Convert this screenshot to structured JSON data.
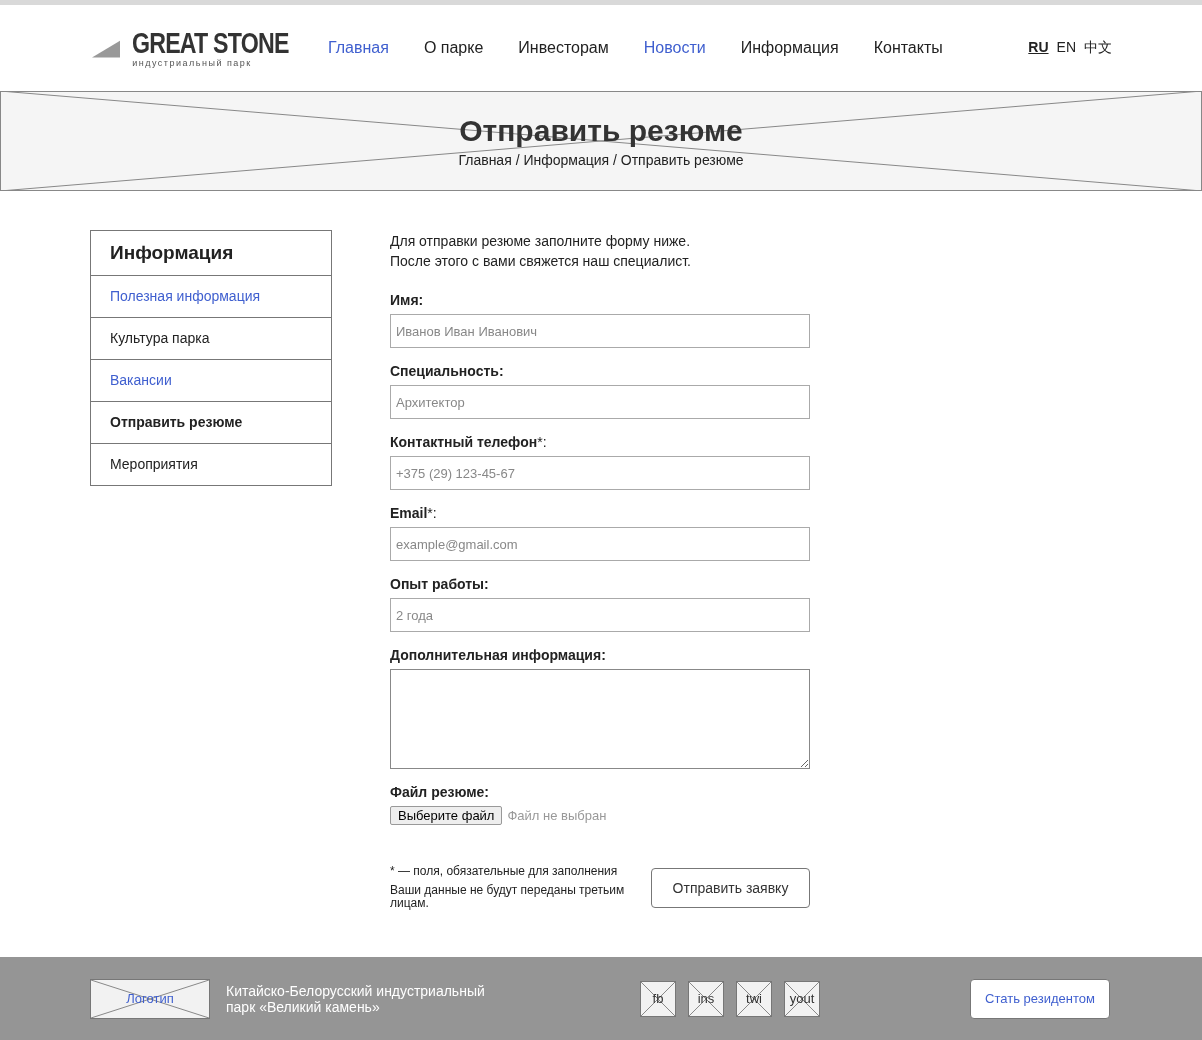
{
  "header": {
    "logo": {
      "title": "GREAT STONE",
      "subtitle": "индустриальный парк"
    },
    "nav": [
      {
        "label": "Главная",
        "kind": "link"
      },
      {
        "label": "О парке",
        "kind": "plain"
      },
      {
        "label": "Инвесторам",
        "kind": "plain"
      },
      {
        "label": "Новости",
        "kind": "link"
      },
      {
        "label": "Информация",
        "kind": "plain"
      },
      {
        "label": "Контакты",
        "kind": "plain"
      }
    ],
    "languages": [
      {
        "label": "RU",
        "selected": true
      },
      {
        "label": "EN",
        "selected": false
      },
      {
        "label": "中文",
        "selected": false
      }
    ]
  },
  "banner": {
    "title": "Отправить резюме",
    "breadcrumbs": "Главная / Информация / Отправить резюме"
  },
  "sidebar": {
    "title": "Информация",
    "items": [
      {
        "label": "Полезная информация",
        "kind": "link",
        "selected": false
      },
      {
        "label": "Культура парка",
        "kind": "plain",
        "selected": false
      },
      {
        "label": "Вакансии",
        "kind": "link",
        "selected": false
      },
      {
        "label": "Отправить резюме",
        "kind": "plain",
        "selected": true
      },
      {
        "label": "Мероприятия",
        "kind": "plain",
        "selected": false
      }
    ]
  },
  "form": {
    "intro": [
      "Для отправки резюме заполните форму ниже.",
      "После этого с вами свяжется наш специалист."
    ],
    "fields": [
      {
        "kind": "input",
        "label": "Имя:",
        "placeholder": "Иванов Иван Иванович"
      },
      {
        "kind": "input",
        "label": "Специальность:",
        "placeholder": "Архитектор"
      },
      {
        "kind": "input",
        "label": "Контактный телефон",
        "required_mark": "*:",
        "placeholder": "+375 (29) 123-45-67"
      },
      {
        "kind": "input",
        "label": "Email",
        "required_mark": "*:",
        "placeholder": "example@gmail.com"
      },
      {
        "kind": "input",
        "label": "Опыт работы:",
        "placeholder": "2 года"
      },
      {
        "kind": "textarea",
        "label": "Дополнительная информация:"
      },
      {
        "kind": "file",
        "label": "Файл резюме:",
        "button": "Выберите файл",
        "status": "Файл не выбран"
      }
    ],
    "required_note": "* — поля, обязательные для заполнения",
    "privacy_note": "Ваши данные не будут переданы третьим лицам.",
    "submit": "Отправить заявку"
  },
  "footer": {
    "logo": "Логотип",
    "text": "Китайско-Белорусский индустриальный парк «Великий камень»",
    "social": [
      "fb",
      "ins",
      "twi",
      "yout"
    ],
    "button": "Стать резидентом"
  }
}
